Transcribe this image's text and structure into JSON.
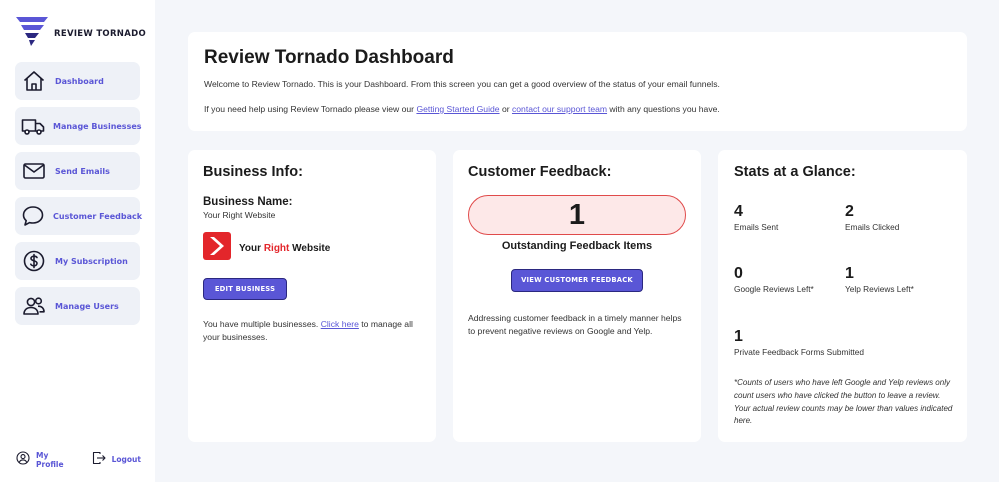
{
  "brand": {
    "name": "REVIEW TORNADO"
  },
  "sidebar": {
    "items": [
      {
        "label": "Dashboard",
        "icon": "home-icon"
      },
      {
        "label": "Manage Businesses",
        "icon": "truck-icon"
      },
      {
        "label": "Send Emails",
        "icon": "envelope-icon"
      },
      {
        "label": "Customer Feedback",
        "icon": "chat-bubble-icon"
      },
      {
        "label": "My Subscription",
        "icon": "dollar-icon"
      },
      {
        "label": "Manage Users",
        "icon": "users-icon"
      }
    ],
    "footer": {
      "profile_label": "My Profile",
      "logout_label": "Logout"
    }
  },
  "header": {
    "title": "Review Tornado Dashboard",
    "intro": "Welcome to Review Tornado. This is your Dashboard. From this screen you can get a good overview of the status of your email funnels.",
    "help_prefix": "If you need help using Review Tornado please view our ",
    "help_link1": "Getting Started Guide",
    "help_middle": " or ",
    "help_link2": "contact our support team",
    "help_suffix": " with any questions you have."
  },
  "business": {
    "title": "Business Info:",
    "name_label": "Business Name:",
    "name_value": "Your Right Website",
    "logo_word1": "Your ",
    "logo_word2": "Right",
    "logo_word3": " Website",
    "edit_button": "EDIT BUSINESS",
    "note_prefix": "You have multiple businesses. ",
    "note_link": "Click here",
    "note_suffix": " to manage all your businesses."
  },
  "feedback": {
    "title": "Customer Feedback:",
    "count": "1",
    "count_label": "Outstanding Feedback Items",
    "view_button": "VIEW CUSTOMER FEEDBACK",
    "note": "Addressing customer feedback in a timely manner helps to prevent negative reviews on Google and Yelp."
  },
  "stats": {
    "title": "Stats at a Glance:",
    "items": [
      {
        "value": "4",
        "label": "Emails Sent"
      },
      {
        "value": "2",
        "label": "Emails Clicked"
      },
      {
        "value": "0",
        "label": "Google Reviews Left*"
      },
      {
        "value": "1",
        "label": "Yelp Reviews Left*"
      },
      {
        "value": "1",
        "label": "Private Feedback Forms Submitted"
      }
    ],
    "note": "*Counts of users who have left Google and Yelp reviews only count users who have clicked the button to leave a review. Your actual review counts may be lower than values indicated here."
  },
  "colors": {
    "accent": "#5a56d6",
    "feedback_bg": "#fde8e8",
    "feedback_border": "#e04a4a",
    "logo_red": "#e3262b"
  }
}
